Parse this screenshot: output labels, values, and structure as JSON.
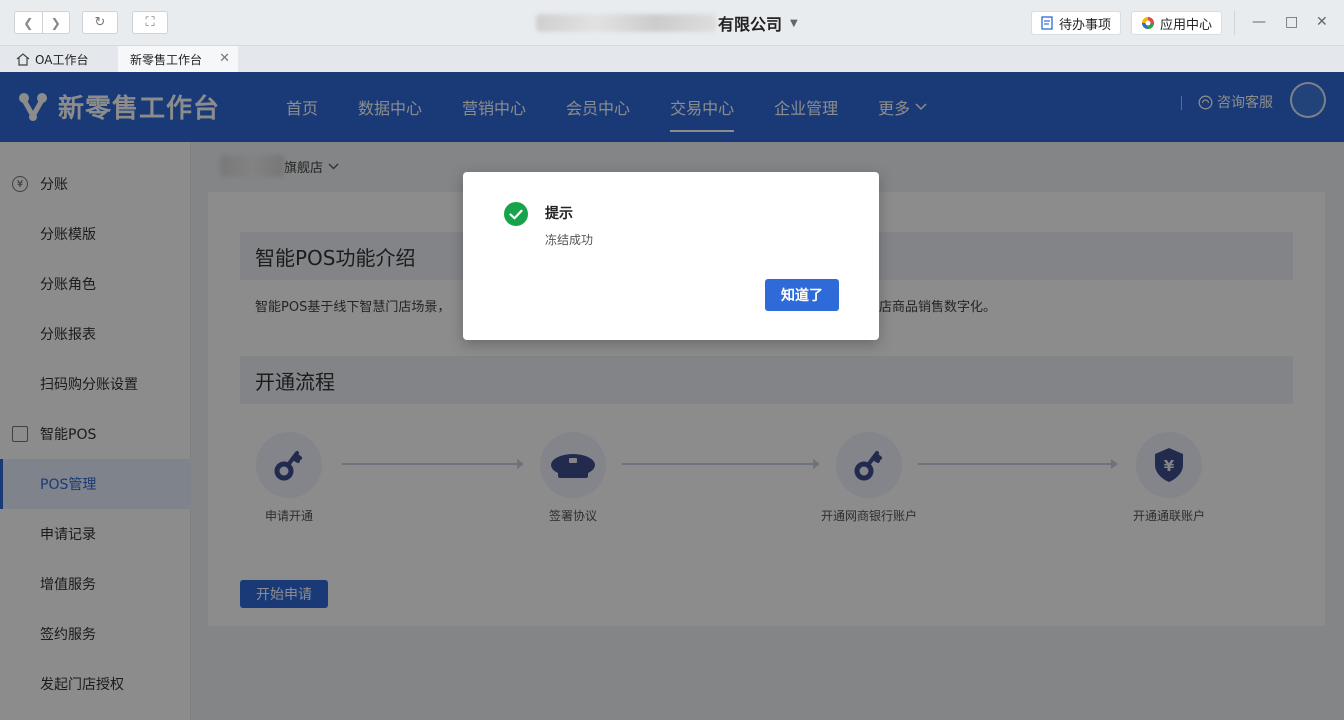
{
  "titlebar": {
    "company_suffix": "有限公司",
    "todo_label": "待办事项",
    "appcenter_label": "应用中心"
  },
  "tabs": [
    {
      "label": "OA工作台"
    },
    {
      "label": "新零售工作台"
    }
  ],
  "app": {
    "title": "新零售工作台",
    "nav": [
      "首页",
      "数据中心",
      "营销中心",
      "会员中心",
      "交易中心",
      "企业管理",
      "更多"
    ],
    "active_nav": "交易中心",
    "consult_label": "咨询客服"
  },
  "sidebar": {
    "groups": [
      {
        "label": "分账",
        "icon": "yen-circle-icon",
        "items": [
          "分账模版",
          "分账角色",
          "分账报表",
          "扫码购分账设置"
        ]
      },
      {
        "label": "智能POS",
        "icon": "pos-device-icon",
        "items": [
          "POS管理",
          "申请记录",
          "增值服务",
          "签约服务",
          "发起门店授权"
        ]
      }
    ],
    "selected": "POS管理"
  },
  "content": {
    "store_suffix": "旗舰店",
    "intro_title": "智能POS功能介绍",
    "intro_text_left": "智能POS基于线下智慧门店场景，",
    "intro_text_right": "门店商品销售数字化。",
    "process_title": "开通流程",
    "steps": [
      "申请开通",
      "签署协议",
      "开通网商银行账户",
      "开通通联账户"
    ],
    "start_button": "开始申请"
  },
  "modal": {
    "title": "提示",
    "message": "冻结成功",
    "button": "知道了"
  },
  "colors": {
    "brand": "#2e6bd9",
    "success": "#17a34a"
  }
}
